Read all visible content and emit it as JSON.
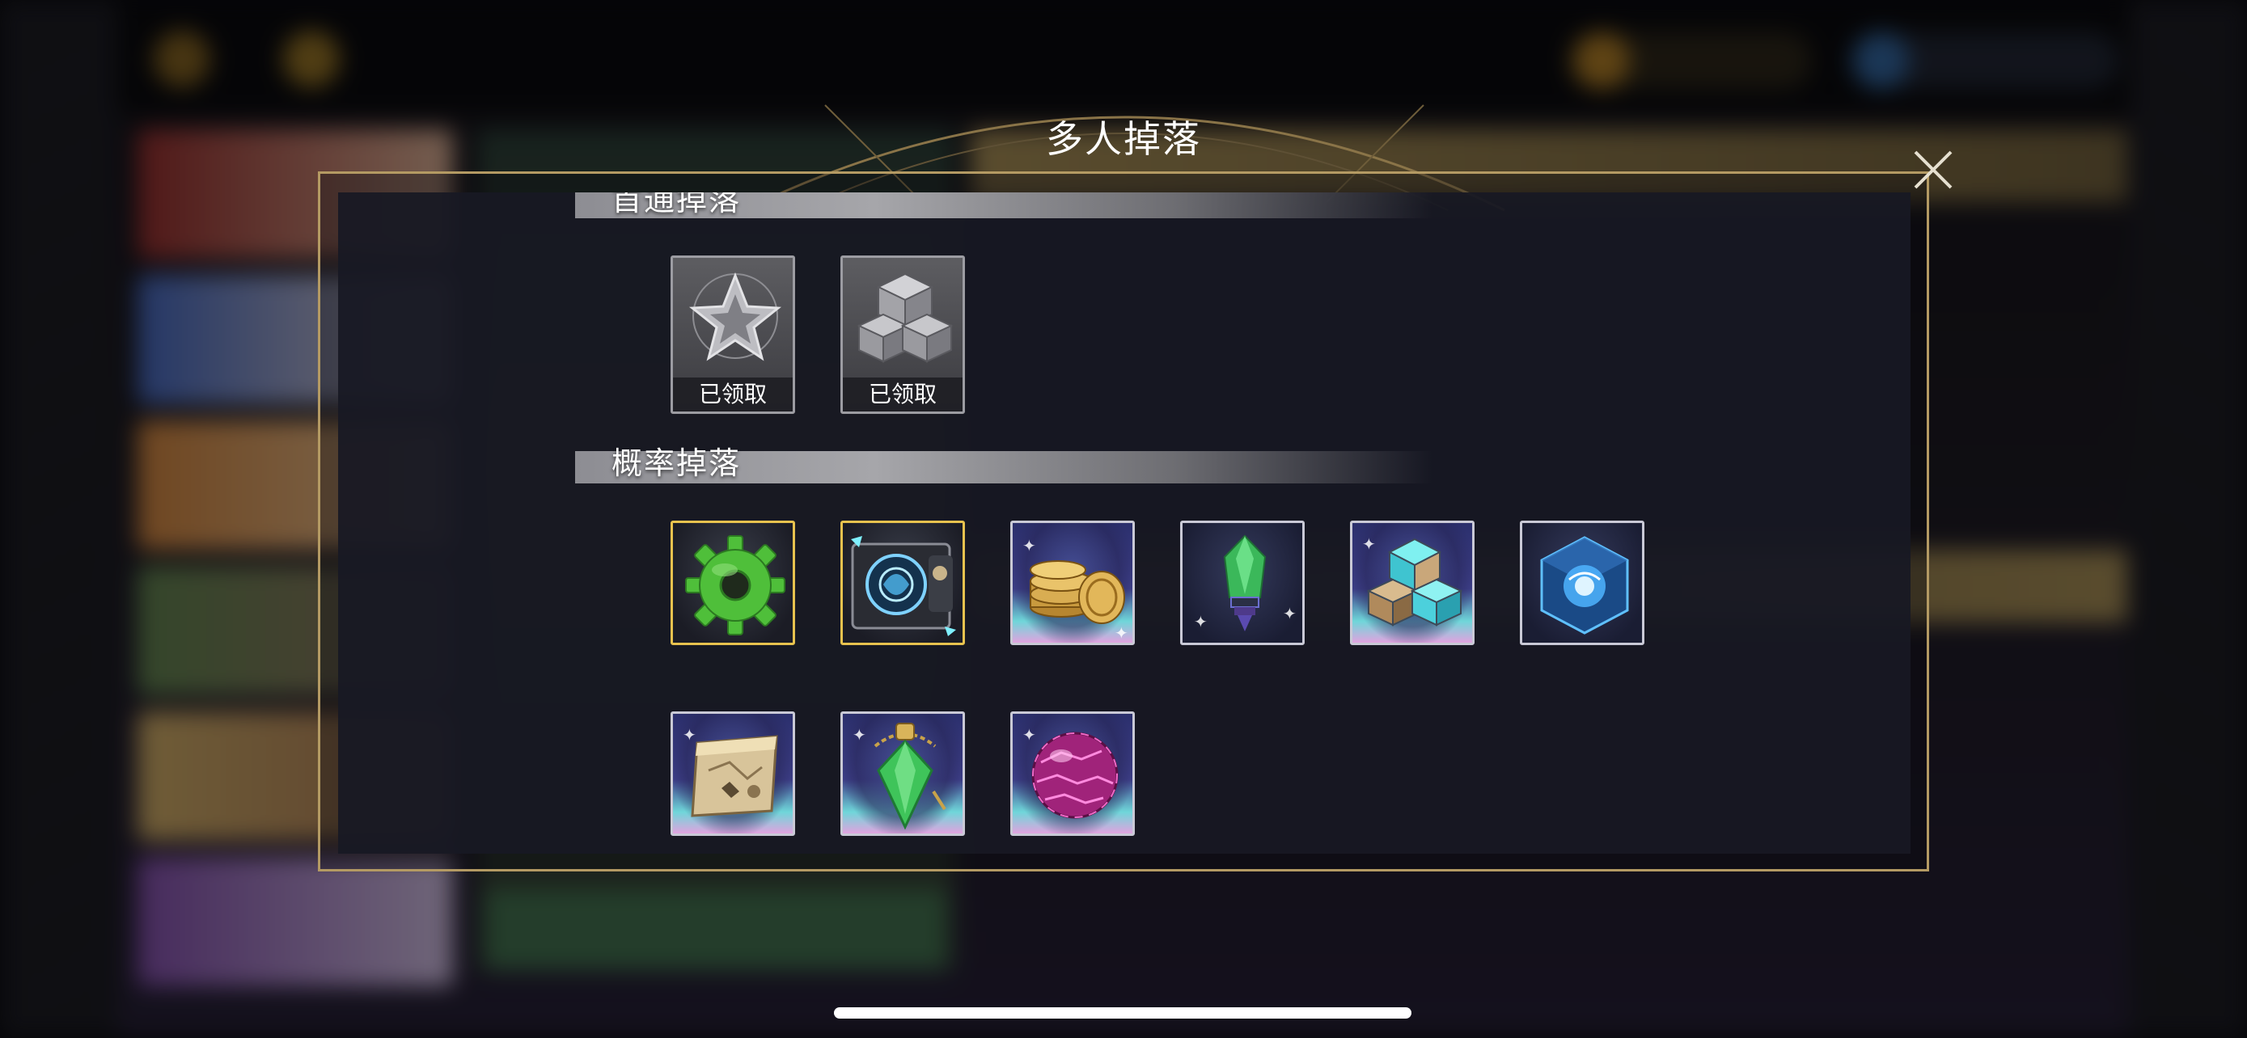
{
  "dialog": {
    "title": "多人掉落",
    "close_icon": "close-icon"
  },
  "sections": {
    "first_drop": {
      "title": "首通掉落",
      "items": [
        {
          "icon": "silver-star-badge-icon",
          "status": "已领取"
        },
        {
          "icon": "gray-cubes-icon",
          "status": "已领取"
        }
      ]
    },
    "chance_drop": {
      "title": "概率掉落",
      "items": [
        {
          "icon": "green-gear-icon",
          "rarity": "gold"
        },
        {
          "icon": "blue-portal-card-icon",
          "rarity": "gold"
        },
        {
          "icon": "gold-coins-icon",
          "rarity": "holo"
        },
        {
          "icon": "green-crystal-icon",
          "rarity": "blue"
        },
        {
          "icon": "teal-cubes-icon",
          "rarity": "holo"
        },
        {
          "icon": "blue-cube-core-icon",
          "rarity": "blue"
        },
        {
          "icon": "scroll-map-icon",
          "rarity": "holo"
        },
        {
          "icon": "green-pendant-icon",
          "rarity": "holo"
        },
        {
          "icon": "pink-orb-icon",
          "rarity": "holo"
        }
      ]
    }
  },
  "colors": {
    "frame": "#b49a63",
    "gold_border": "#e7c24e",
    "panel": "#181924"
  }
}
